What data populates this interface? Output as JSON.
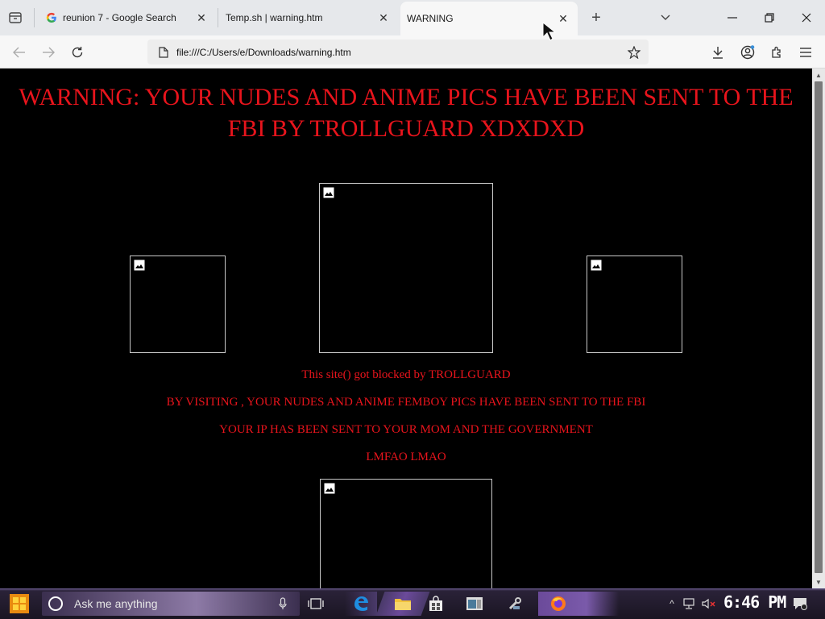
{
  "browser": {
    "tabs": [
      {
        "title": "reunion 7 - Google Search",
        "favicon": "google-icon",
        "active": false
      },
      {
        "title": "Temp.sh | warning.htm",
        "favicon": "none",
        "active": false
      },
      {
        "title": "WARNING",
        "favicon": "none",
        "active": true
      }
    ],
    "url": "file:///C:/Users/e/Downloads/warning.htm"
  },
  "page": {
    "headline": "WARNING: YOUR NUDES AND ANIME PICS HAVE BEEN SENT TO THE FBI BY TROLLGUARD XDXDXD",
    "lines": [
      "This site() got blocked by TROLLGUARD",
      "BY VISITING , YOUR NUDES AND ANIME FEMBOY PICS HAVE BEEN SENT TO THE FBI",
      "YOUR IP HAS BEEN SENT TO YOUR MOM AND THE GOVERNMENT",
      "LMFAO LMAO"
    ],
    "text_color": "#e8141c",
    "background": "#000000"
  },
  "taskbar": {
    "search_placeholder": "Ask me anything",
    "clock": "6:46 PM"
  }
}
